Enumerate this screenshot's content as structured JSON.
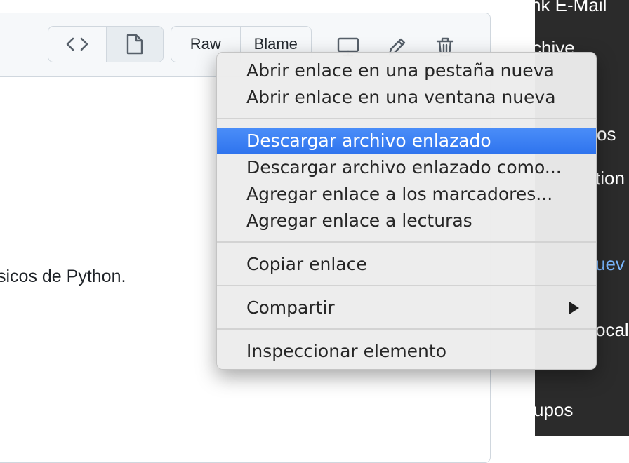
{
  "toolbar": {
    "raw_label": "Raw",
    "blame_label": "Blame"
  },
  "content": {
    "body_text": "sicos de Python."
  },
  "sidebar_bg": {
    "items": [
      "nk E-Mail",
      "chive",
      "os",
      "tion",
      "uev",
      "ocal",
      "upos"
    ]
  },
  "context_menu": {
    "items": [
      {
        "label": "Abrir enlace en una pestaña nueva"
      },
      {
        "label": "Abrir enlace en una ventana nueva"
      },
      {
        "label": "Descargar archivo enlazado"
      },
      {
        "label": "Descargar archivo enlazado como..."
      },
      {
        "label": "Agregar enlace a los marcadores..."
      },
      {
        "label": "Agregar enlace a lecturas"
      },
      {
        "label": "Copiar enlace"
      },
      {
        "label": "Compartir"
      },
      {
        "label": "Inspeccionar elemento"
      }
    ],
    "highlighted": "Descargar archivo enlazado",
    "highlight_color": "#3e82f7"
  },
  "icons": [
    "code-icon",
    "file-icon",
    "desktop-icon",
    "pencil-icon",
    "trash-icon",
    "submenu-arrow-icon"
  ]
}
